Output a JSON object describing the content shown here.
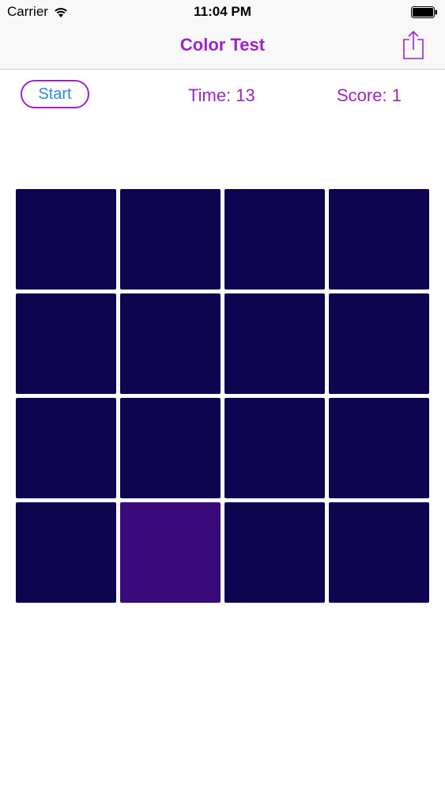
{
  "status_bar": {
    "carrier": "Carrier",
    "time": "11:04 PM"
  },
  "nav": {
    "title": "Color Test",
    "share_icon": "share-icon"
  },
  "controls": {
    "start_label": "Start",
    "time_text": "Time: 13",
    "score_text": "Score: 1"
  },
  "colors": {
    "accent": "#9b24c9",
    "link_blue": "#2f86e0",
    "tile_base": "#0e0550",
    "tile_odd": "#3a0a7a"
  },
  "grid": {
    "rows": 4,
    "cols": 4,
    "odd_tile_index": 13
  }
}
